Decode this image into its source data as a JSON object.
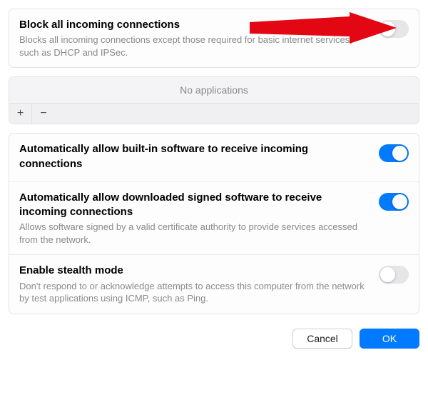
{
  "colors": {
    "accent": "#007aff",
    "arrow": "#e30613"
  },
  "block_all": {
    "title": "Block all incoming connections",
    "desc": "Blocks all incoming connections except those required for basic internet services, such as DHCP and IPSec.",
    "enabled": false
  },
  "apps": {
    "empty_label": "No applications",
    "add_icon": "+",
    "remove_icon": "−"
  },
  "auto_builtin": {
    "title": "Automatically allow built-in software to receive incoming connections",
    "enabled": true
  },
  "auto_signed": {
    "title": "Automatically allow downloaded signed software to receive incoming connections",
    "desc": "Allows software signed by a valid certificate authority to provide services accessed from the network.",
    "enabled": true
  },
  "stealth": {
    "title": "Enable stealth mode",
    "desc": "Don't respond to or acknowledge attempts to access this computer from the network by test applications using ICMP, such as Ping.",
    "enabled": false
  },
  "buttons": {
    "cancel": "Cancel",
    "ok": "OK"
  }
}
